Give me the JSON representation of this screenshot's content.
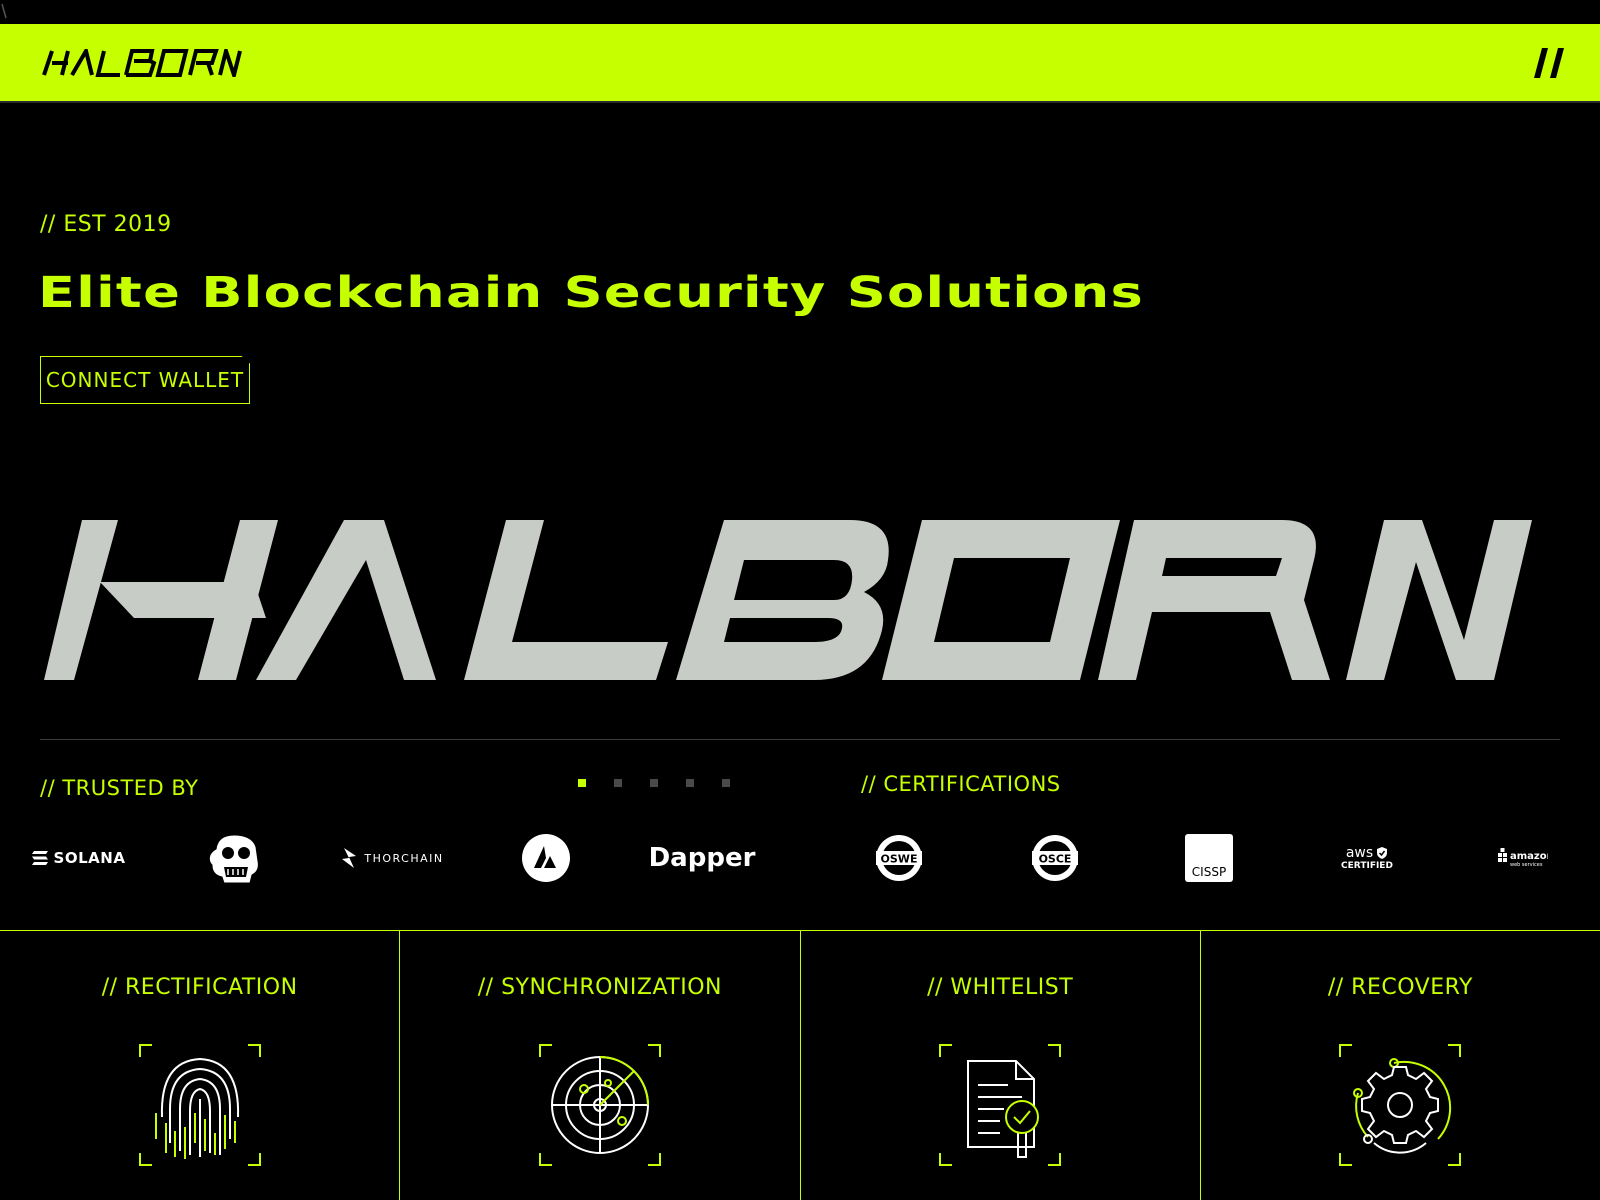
{
  "brand": {
    "name": "HALBORN",
    "accent_color": "#c6ff00",
    "background_color": "#000000",
    "wordmark_color": "#c8ccc6"
  },
  "header": {
    "logo_text": "HALBORN",
    "menu_icon": "menu-slashes-icon"
  },
  "hero": {
    "est": "// EST 2019",
    "headline": "Elite Blockchain Security Solutions",
    "connect_label": "CONNECT WALLET"
  },
  "trusted": {
    "label": "// TRUSTED BY",
    "logos": [
      {
        "name": "SOLANA",
        "icon": "solana-logo"
      },
      {
        "name": "",
        "icon": "bored-ape-logo"
      },
      {
        "name": "THORCHAIN",
        "icon": "thorchain-logo"
      },
      {
        "name": "",
        "icon": "avalanche-logo"
      },
      {
        "name": "Dapper",
        "icon": "dapper-logo"
      }
    ]
  },
  "carousel": {
    "pages": 5,
    "active_index": 0
  },
  "certifications": {
    "label": "// CERTIFICATIONS",
    "items": [
      {
        "name": "OSWE",
        "icon": "oswe-badge"
      },
      {
        "name": "OSCE",
        "icon": "osce-badge"
      },
      {
        "name": "CISSP",
        "icon": "cissp-badge"
      },
      {
        "name": "aws",
        "sub": "CERTIFIED",
        "icon": "aws-certified-badge"
      },
      {
        "name": "amazon",
        "sub": "web services",
        "icon": "amazon-web-services-logo"
      }
    ]
  },
  "features": [
    {
      "title": "// RECTIFICATION",
      "icon": "fingerprint-icon"
    },
    {
      "title": "// SYNCHRONIZATION",
      "icon": "radar-icon"
    },
    {
      "title": "// WHITELIST",
      "icon": "document-check-icon"
    },
    {
      "title": "// RECOVERY",
      "icon": "gear-cycle-icon"
    }
  ]
}
